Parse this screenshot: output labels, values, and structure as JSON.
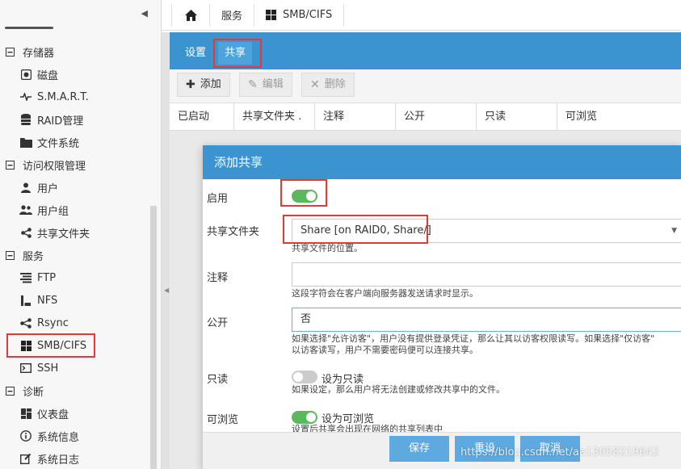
{
  "sidebar": {
    "collapse_icon": "triangle-left-icon",
    "items": [
      {
        "label": "存储器",
        "type": "group",
        "icon": "minus-square-icon"
      },
      {
        "label": "磁盘",
        "type": "child",
        "icon": "disk-icon"
      },
      {
        "label": "S.M.A.R.T.",
        "type": "child",
        "icon": "pulse-icon"
      },
      {
        "label": "RAID管理",
        "type": "child",
        "icon": "database-icon"
      },
      {
        "label": "文件系统",
        "type": "child",
        "icon": "folder-icon"
      },
      {
        "label": "访问权限管理",
        "type": "group",
        "icon": "minus-square-icon"
      },
      {
        "label": "用户",
        "type": "child",
        "icon": "user-icon"
      },
      {
        "label": "用户组",
        "type": "child",
        "icon": "users-icon"
      },
      {
        "label": "共享文件夹",
        "type": "child",
        "icon": "share-icon"
      },
      {
        "label": "服务",
        "type": "group",
        "icon": "minus-square-icon"
      },
      {
        "label": "FTP",
        "type": "child",
        "icon": "ftp-icon"
      },
      {
        "label": "NFS",
        "type": "child",
        "icon": "nfs-icon"
      },
      {
        "label": "Rsync",
        "type": "child",
        "icon": "rsync-icon"
      },
      {
        "label": "SMB/CIFS",
        "type": "child",
        "icon": "windows-icon"
      },
      {
        "label": "SSH",
        "type": "child",
        "icon": "terminal-icon"
      },
      {
        "label": "诊断",
        "type": "group",
        "icon": "minus-square-icon"
      },
      {
        "label": "仪表盘",
        "type": "child",
        "icon": "dashboard-icon"
      },
      {
        "label": "系统信息",
        "type": "child",
        "icon": "info-icon"
      },
      {
        "label": "系统日志",
        "type": "child",
        "icon": "edit-icon"
      }
    ]
  },
  "topbar": {
    "home_icon": "home-icon",
    "crumbs": [
      "服务",
      "SMB/CIFS"
    ]
  },
  "tabs": [
    "设置",
    "共享"
  ],
  "toolbar": {
    "add": "添加",
    "edit": "编辑",
    "delete": "删除"
  },
  "grid": {
    "columns": [
      "已启动",
      "共享文件夹 .",
      "注释",
      "公开",
      "只读",
      "可浏览"
    ]
  },
  "modal": {
    "title": "添加共享",
    "enable_label": "启用",
    "enable_on": true,
    "shared_folder_label": "共享文件夹",
    "shared_folder_value": "Share [on RAID0, Share/]",
    "shared_folder_hint": "共享文件的位置。",
    "comment_label": "注释",
    "comment_value": "",
    "comment_hint": "这段字符会在客户端向服务器发送请求时显示。",
    "public_label": "公开",
    "public_value": "否",
    "public_hint_1": "如果选择\"允许访客\"，用户没有提供登录凭证，那么让其以访客权限读写。如果选择\"仅访客\"",
    "public_hint_2": "以访客读写，用户不需要密码便可以连接共享。",
    "readonly_label": "只读",
    "readonly_on": false,
    "readonly_text": "设为只读",
    "readonly_hint": "如果设定，那么用户将无法创建或修改共享中的文件。",
    "browsable_label": "可浏览",
    "browsable_on": true,
    "browsable_text": "设为可浏览",
    "browsable_hint": "设置后共享会出现在网络的共享列表中",
    "save": "保存",
    "reset": "重设",
    "cancel": "取消"
  },
  "watermark": "https://blog.csdn.net/aa13058219642",
  "colors": {
    "accent": "#3b93d0",
    "button": "#5ea9df",
    "switch_on": "#5cb85c",
    "highlight": "#e53935"
  }
}
